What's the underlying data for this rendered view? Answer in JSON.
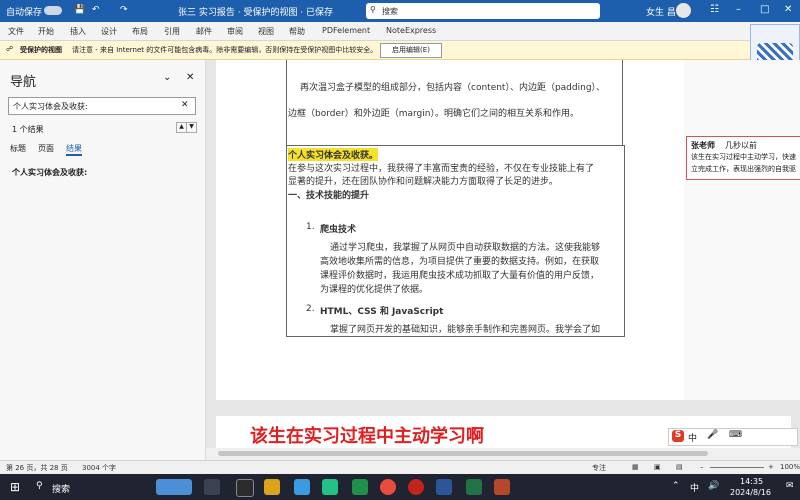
{
  "titlebar": {
    "autosave_label": "自动保存",
    "doc_title": "张三 实习报告 · 受保护的视图 · 已保存",
    "search_placeholder": "搜索",
    "user": "女生 昌"
  },
  "ribbon": {
    "tabs": [
      "文件",
      "开始",
      "插入",
      "设计",
      "布局",
      "引用",
      "邮件",
      "审阅",
      "视图",
      "帮助",
      "PDFelement",
      "NoteExpress"
    ]
  },
  "protected_bar": {
    "title": "受保护的视图",
    "message": "请注意 - 来自 Internet 的文件可能包含病毒。除非需要编辑，否则保持在受保护视图中比较安全。",
    "enable_button": "启用编辑(E)"
  },
  "nav": {
    "title": "导航",
    "search_value": "个人实习体会及收获:",
    "result_count": "1 个结果",
    "tabs": [
      "标题",
      "页面",
      "结果"
    ],
    "active_tab": "结果",
    "result_item": "个人实习体会及收获:"
  },
  "document": {
    "para1_a": "再次温习盒子模型的组成部分，包括内容（content）、内边距（padding）、",
    "para1_b": "边框（border）和外边距（margin）。明确它们之间的相互关系和作用。",
    "heading": "个人实习体会及收获。",
    "intro_a": "在参与这次实习过程中，我获得了丰富而宝贵的经验，不仅在专业技能上有了",
    "intro_b": "显著的提升，还在团队协作和问题解决能力方面取得了长足的进步。",
    "section1": "一、技术技能的提升",
    "item1_title": "爬虫技术",
    "item1_a": "通过学习爬虫，我掌握了从网页中自动获取数据的方法。这使我能够",
    "item1_b": "高效地收集所需的信息，为项目提供了重要的数据支持。例如，在获取",
    "item1_c": "课程评价数据时，我运用爬虫技术成功抓取了大量有价值的用户反馈，",
    "item1_d": "为课程的优化提供了依据。",
    "item2_title": "HTML、CSS 和 JavaScript",
    "item2_a": "掌握了网页开发的基础知识，能够亲手制作和完善网页。我学会了如"
  },
  "comment": {
    "author": "张老师",
    "time": "几秒以前",
    "line1": "该生在实习过程中主动学习，快速",
    "line2": "立完成工作，表现出强烈的自我驱"
  },
  "caption": "该生在实习过程中主动学习啊",
  "statusbar": {
    "page": "第 26 页，共 28 页",
    "words": "3004 个字",
    "focus": "专注",
    "zoom": "100%"
  },
  "taskbar": {
    "search": "搜索",
    "time": "14:35",
    "date": "2024/8/16",
    "lang": "中"
  },
  "ime": {
    "label": "中"
  },
  "colors": {
    "titlebar": "#1d5fad",
    "caption": "#e02020",
    "heading_highlight": "#f5e02a"
  }
}
